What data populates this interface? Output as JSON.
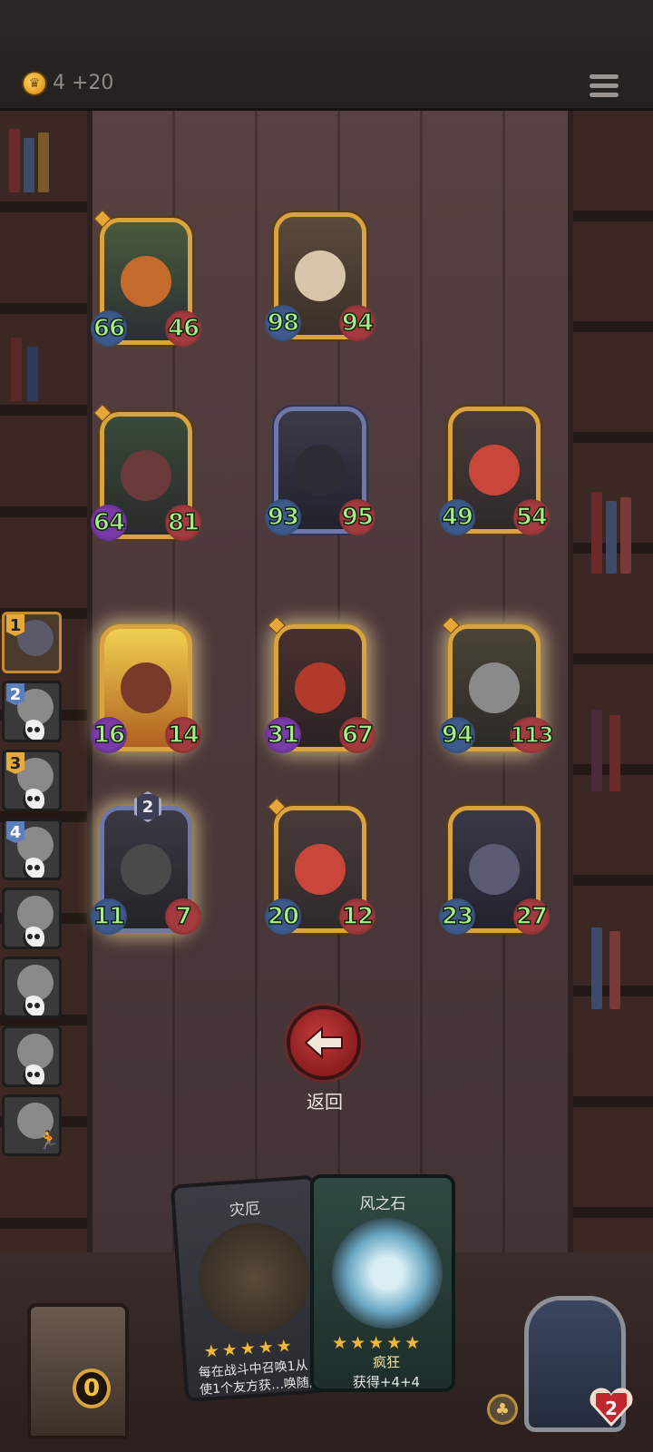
{
  "topbar": {
    "gold": "4",
    "gold_income": "+20"
  },
  "board_units": [
    {
      "id": "pumpkin-lock",
      "atk": "66",
      "hp": "46",
      "frame": "gold"
    },
    {
      "id": "old-woman",
      "atk": "98",
      "hp": "94",
      "frame": "gold"
    },
    {
      "id": "boar",
      "atk": "64",
      "hp": "81",
      "frame": "gold"
    },
    {
      "id": "hooded-rogue",
      "atk": "93",
      "hp": "95",
      "frame": "blue"
    },
    {
      "id": "red-hair-mystic",
      "atk": "49",
      "hp": "54",
      "frame": "gold"
    },
    {
      "id": "fire-brute",
      "atk": "16",
      "hp": "14",
      "frame": "gold"
    },
    {
      "id": "red-hood-assassin",
      "atk": "31",
      "hp": "67",
      "frame": "gold"
    },
    {
      "id": "armored-knight",
      "atk": "94",
      "hp": "113",
      "frame": "gold"
    },
    {
      "id": "shield-guard",
      "atk": "11",
      "hp": "7",
      "frame": "blue",
      "level": "2"
    },
    {
      "id": "red-hair-mystic-2",
      "atk": "20",
      "hp": "12",
      "frame": "gold"
    },
    {
      "id": "rat-bandit",
      "atk": "23",
      "hp": "27",
      "frame": "gold"
    }
  ],
  "roster": [
    "1",
    "2",
    "3",
    "4"
  ],
  "back_label": "返回",
  "cards": [
    {
      "title": "灾厄",
      "text": "每在战斗中召唤1从，使1个友方获…唤随从的属性"
    },
    {
      "title": "风之石",
      "keyword": "疯狂",
      "text": "获得+4+4"
    }
  ],
  "chest_count": "0",
  "hero_hp": "2",
  "colors": {
    "gold_frame": "#d9a440",
    "blue_frame": "#6f76a8",
    "stat_text": "#a6f08a",
    "back_button": "#c43a3a"
  }
}
